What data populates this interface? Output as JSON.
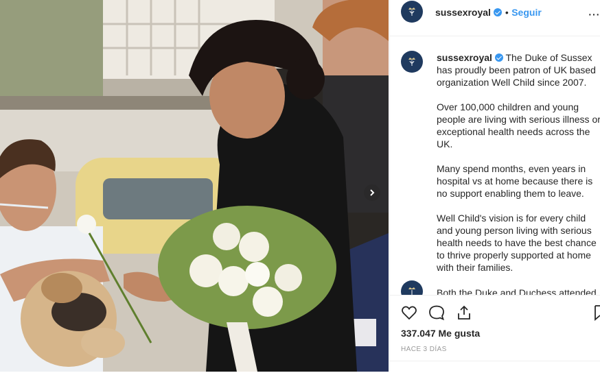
{
  "post": {
    "username": "sussexroyal",
    "separator": "•",
    "follow_label": "Seguir",
    "more_label": "···",
    "caption_paragraphs": [
      "The Duke of Sussex has proudly been patron of UK based organization Well Child since 2007.",
      "Over 100,000 children and young people are living with serious illness or exceptional health needs across the UK.",
      "Many spend months, even years in hospital vs at home because there is no support enabling them to leave.",
      "Well Child's vision is for every child and young person living with serious health needs to have the best chance to thrive properly supported at home with their families."
    ],
    "next_comment_preview": "Both the Duke and Duchess attended",
    "likes": "337.047 Me gusta",
    "time_ago": "HACE 3 DÍAS"
  },
  "icons": {
    "avatar": "crest-icon",
    "verified": "verified-badge-icon",
    "like": "heart-icon",
    "comment": "comment-icon",
    "share": "share-icon",
    "save": "bookmark-icon",
    "next": "chevron-right-icon"
  },
  "colors": {
    "accent": "#3897f0",
    "avatar_bg": "#1f3a5f",
    "border": "#efefef",
    "muted": "#999999"
  }
}
